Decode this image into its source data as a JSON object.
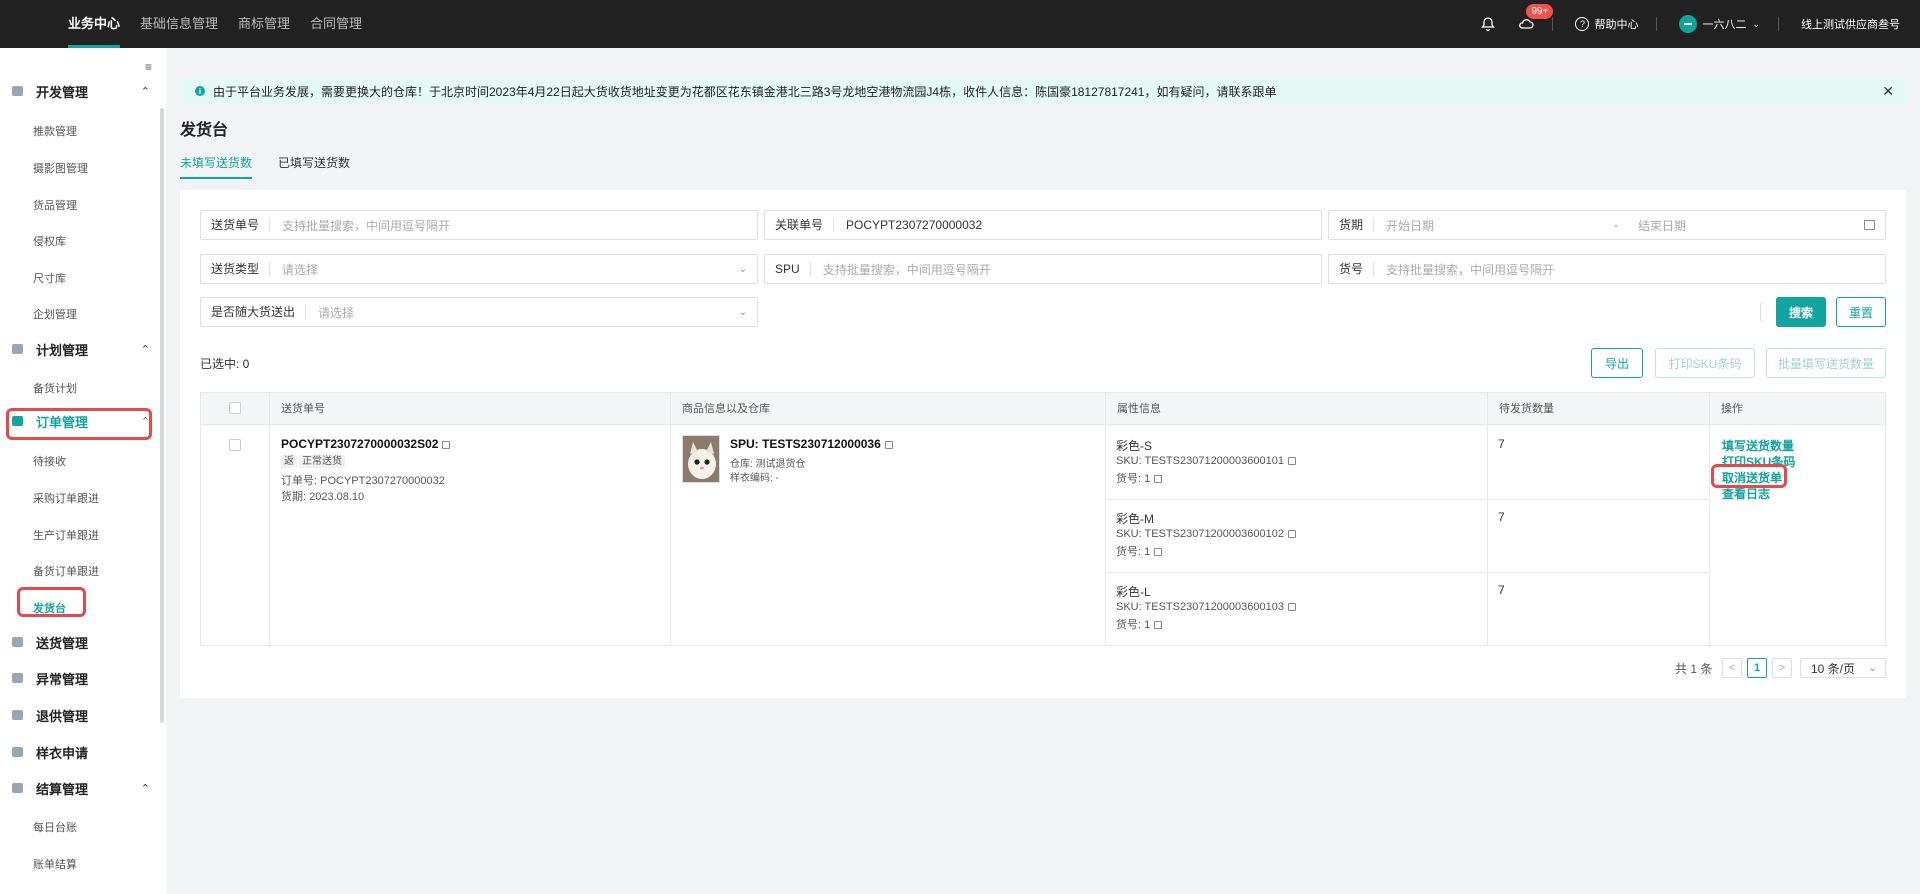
{
  "topnav": {
    "items": [
      "业务中心",
      "基础信息管理",
      "商标管理",
      "合同管理"
    ],
    "badge": "99+",
    "help": "帮助中心",
    "user": "一六八二",
    "supplier": "线上测试供应商叁号"
  },
  "sidebar": {
    "groups": [
      {
        "label": "开发管理",
        "items": [
          "推款管理",
          "摄影图管理",
          "货品管理",
          "侵权库",
          "尺寸库",
          "企划管理"
        ]
      },
      {
        "label": "计划管理",
        "items": [
          "备货计划"
        ]
      },
      {
        "label": "订单管理",
        "items": [
          "待接收",
          "采购订单跟进",
          "生产订单跟进",
          "备货订单跟进",
          "发货台"
        ]
      },
      {
        "label": "送货管理"
      },
      {
        "label": "异常管理"
      },
      {
        "label": "退供管理"
      },
      {
        "label": "样衣申请"
      },
      {
        "label": "结算管理",
        "items": [
          "每日台账",
          "账单结算"
        ]
      }
    ]
  },
  "notice": "由于平台业务发展，需要更换大的仓库！于北京时间2023年4月22日起大货收货地址变更为花都区花东镇金港北三路3号龙地空港物流园J4栋，收件人信息：陈国豪18127817241，如有疑问，请联系跟单",
  "page": {
    "title": "发货台",
    "tabs": [
      "未填写送货数",
      "已填写送货数"
    ]
  },
  "filters": {
    "delivery_no": {
      "label": "送货单号",
      "placeholder": "支持批量搜索，中间用逗号隔开"
    },
    "related_no": {
      "label": "关联单号",
      "value": "POCYPT2307270000032"
    },
    "period": {
      "label": "货期",
      "start": "开始日期",
      "end": "结束日期",
      "dash": "-"
    },
    "delivery_type": {
      "label": "送货类型",
      "placeholder": "请选择"
    },
    "spu": {
      "label": "SPU",
      "placeholder": "支持批量搜索，中间用逗号隔开"
    },
    "item_no": {
      "label": "货号",
      "placeholder": "支持批量搜索，中间用逗号隔开"
    },
    "with_bulk": {
      "label": "是否随大货送出",
      "placeholder": "请选择"
    },
    "search_label": "搜索",
    "reset_label": "重置"
  },
  "toolbar": {
    "selected": "已选中: 0",
    "export": "导出",
    "print_sku": "打印SKU条码",
    "batch_fill": "批量填写送货数量"
  },
  "table": {
    "headers": [
      "送货单号",
      "商品信息以及仓库",
      "属性信息",
      "待发货数量",
      "操作"
    ],
    "row": {
      "delivery_no": "POCYPT2307270000032S02",
      "tag_flag": "返",
      "tag_type": "正常送货",
      "order_no": "订单号: POCYPT2307270000032",
      "due_date": "货期: 2023.08.10",
      "spu": "SPU: TESTS230712000036",
      "warehouse": "仓库: 测试退货仓",
      "sample_code": "样衣编码: -",
      "skus": [
        {
          "attr": "彩色-S",
          "sku": "SKU: TESTS23071200003600101",
          "item": "货号: 1",
          "qty": "7"
        },
        {
          "attr": "彩色-M",
          "sku": "SKU: TESTS23071200003600102",
          "item": "货号: 1",
          "qty": "7"
        },
        {
          "attr": "彩色-L",
          "sku": "SKU: TESTS23071200003600103",
          "item": "货号: 1",
          "qty": "7"
        }
      ],
      "actions": [
        "填写送货数量",
        "打印SKU条码",
        "取消送货单",
        "查看日志"
      ]
    }
  },
  "pagination": {
    "total": "共 1 条",
    "prev": "<",
    "current": "1",
    "next": ">",
    "page_size": "10 条/页"
  },
  "colors": {
    "accent": "#12a4a0",
    "highlight": "#e5484d",
    "topbar": "#222222"
  }
}
